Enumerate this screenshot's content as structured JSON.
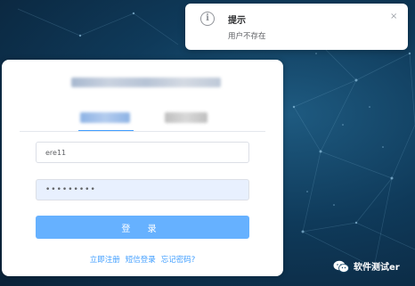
{
  "notification": {
    "icon": "info-icon",
    "title": "提示",
    "message": "用户不存在",
    "close_glyph": "×"
  },
  "login_form": {
    "username_value": "ere11",
    "password_value": "•••••••••",
    "login_button_label": "登 录"
  },
  "links": {
    "register": "立即注册",
    "sms_login": "短信登录",
    "forgot_password": "忘记密码?"
  },
  "watermark": {
    "text": "软件测试er",
    "logo_icon": "wechat-logo"
  },
  "colors": {
    "accent": "#409eff",
    "login_button": "#66b1ff",
    "background": "#0f3a5a",
    "password_autofill": "#e8f0fe"
  }
}
